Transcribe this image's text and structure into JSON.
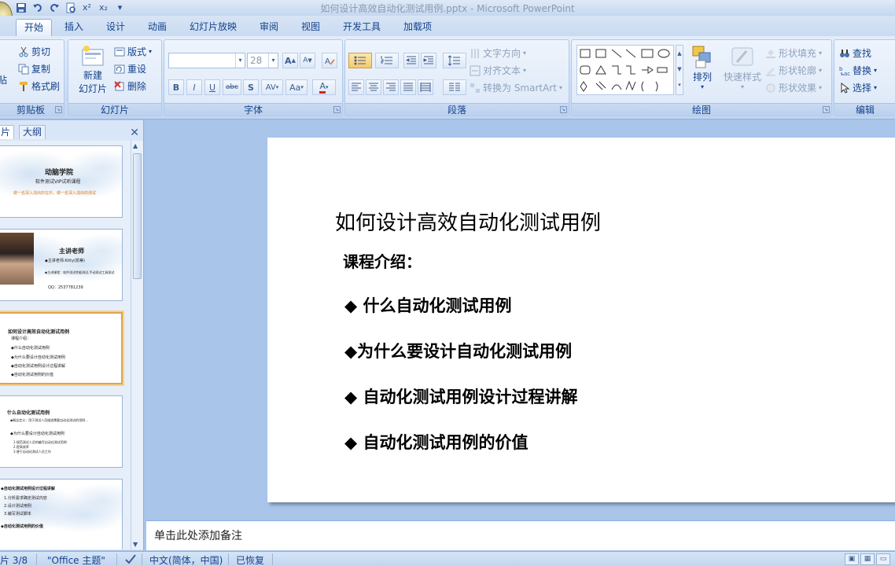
{
  "window": {
    "title": "如何设计高效自动化测试用例.pptx - Microsoft PowerPoint"
  },
  "quick_access": [
    "save-icon",
    "undo-icon",
    "redo-icon",
    "preview-icon",
    "superscript-icon",
    "subscript-icon",
    "customize-icon"
  ],
  "quick_access_text": {
    "superscript": "x²",
    "subscript": "x₂"
  },
  "tabs": [
    "开始",
    "插入",
    "设计",
    "动画",
    "幻灯片放映",
    "审阅",
    "视图",
    "开发工具",
    "加载项"
  ],
  "ribbon": {
    "clipboard": {
      "label": "剪贴板",
      "paste": "贴",
      "cut": "剪切",
      "copy": "复制",
      "format_painter": "格式刷"
    },
    "slides": {
      "label": "幻灯片",
      "new_slide_line1": "新建",
      "new_slide_line2": "幻灯片",
      "layout": "版式",
      "reset": "重设",
      "delete": "删除"
    },
    "font": {
      "label": "字体",
      "font_name": "",
      "font_size": "28",
      "bold": "B",
      "italic": "I",
      "underline": "U",
      "strike": "abc",
      "shadow": "S",
      "spacing": "AV",
      "case": "Aa",
      "color": "A",
      "grow": "A",
      "shrink": "A"
    },
    "paragraph": {
      "label": "段落",
      "text_direction": "文字方向",
      "align_text": "对齐文本",
      "smartart": "转换为 SmartArt"
    },
    "drawing": {
      "label": "绘图",
      "arrange": "排列",
      "quick_styles": "快速样式",
      "shape_fill": "形状填充",
      "shape_outline": "形状轮廓",
      "shape_effects": "形状效果"
    },
    "editing": {
      "label": "编辑",
      "find": "查找",
      "replace": "替换",
      "select": "选择"
    }
  },
  "panel": {
    "tab_slides": "片",
    "tab_outline": "大纲",
    "thumbnails": [
      {
        "title": "动脑学院",
        "subtitle": "软件测试VIP试听课程",
        "tagline": "做一名深入浅出的在乐，做一名深入浅出的测试"
      },
      {
        "title": "主讲老师",
        "line1": "◆主讲老师:Kitty(凯蒂)",
        "line2": "◆主讲课程：软件测试性能测试,手动测试工具测试",
        "line3": "QQ：2537781239"
      },
      {
        "title": "如何设计高效自动化测试用例",
        "line1": "课程介绍：",
        "line2": "◆什么自动化测试用例",
        "line3": "◆为什么要设计自动化测试用例",
        "line4": "◆自动化测试用例设计过程讲解",
        "line5": "◆自动化测试用例的价值"
      },
      {
        "title": "什么自动化测试用例",
        "line1": "◆概念定义：用于测试人员描述需要自动化测试的用例...",
        "line2": "◆为什么要设计自动化测试用例",
        "line3": "1.规范测试人员的编写自动化测试用例",
        "line4": "2.提高效率",
        "line5": "3.便于自动化测试人员工作"
      },
      {
        "title": "◆自动化测试用例设计过程讲解",
        "line1": "1.分析需求确定测试内容",
        "line2": "2.设计测试用例",
        "line3": "3.编写测试脚本",
        "line4": "◆自动化测试用例的价值"
      }
    ]
  },
  "slide": {
    "title": "如何设计高效自动化测试用例",
    "subtitle": "课程介绍：",
    "bullets": [
      "◆ 什么自动化测试用例",
      "◆为什么要设计自动化测试用例",
      "◆ 自动化测试用例设计过程讲解",
      "◆ 自动化测试用例的价值"
    ]
  },
  "notes": {
    "placeholder": "单击此处添加备注"
  },
  "status": {
    "slide": "片 3/8",
    "theme": "\"Office 主题\"",
    "language": "中文(简体，中国)",
    "recovered": "已恢复"
  }
}
